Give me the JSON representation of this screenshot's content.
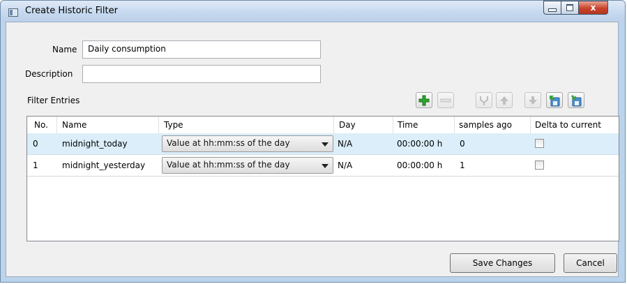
{
  "window": {
    "title": "Create Historic Filter",
    "close_glyph": "x"
  },
  "form": {
    "name_label": "Name",
    "name_value": "Daily consumption",
    "description_label": "Description",
    "description_value": ""
  },
  "filter_entries": {
    "label": "Filter Entries",
    "toolbar_icons": [
      "add-icon",
      "remove-icon",
      "merge-icon",
      "move-up-icon",
      "move-down-icon",
      "import-icon",
      "export-icon"
    ],
    "columns": [
      "No.",
      "Name",
      "Type",
      "Day",
      "Time",
      "samples ago",
      "Delta to current"
    ],
    "rows": [
      {
        "no": "0",
        "name": "midnight_today",
        "type": "Value at hh:mm:ss of the day",
        "day": "N/A",
        "time": "00:00:00 h",
        "samples_ago": "0",
        "delta_checked": false,
        "selected": true
      },
      {
        "no": "1",
        "name": "midnight_yesterday",
        "type": "Value at hh:mm:ss of the day",
        "day": "N/A",
        "time": "00:00:00 h",
        "samples_ago": "1",
        "delta_checked": false,
        "selected": false
      }
    ]
  },
  "buttons": {
    "save": "Save Changes",
    "cancel": "Cancel"
  },
  "colors": {
    "selected_row": "#dbeef9",
    "add_icon": "#2fa52f",
    "title_bar": "#c5d8ee",
    "close_button": "#c8432b"
  }
}
